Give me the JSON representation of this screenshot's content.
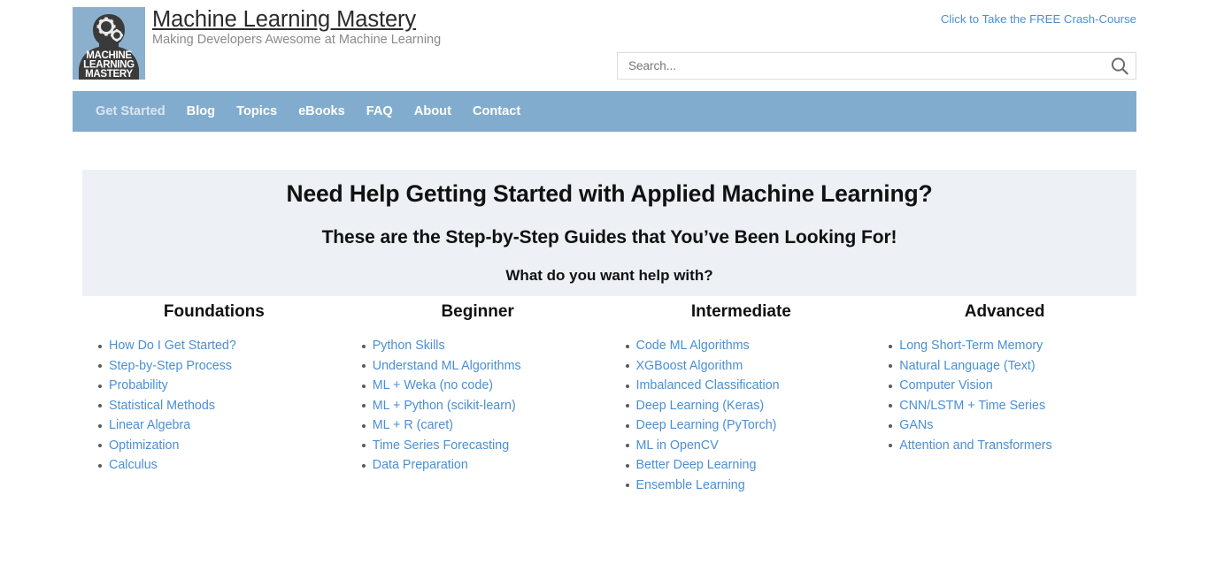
{
  "site": {
    "title": "Machine Learning Mastery",
    "tagline": "Making Developers Awesome at Machine Learning",
    "logo_text_lines": [
      "MACHINE",
      "LEARNING",
      "MASTERY"
    ]
  },
  "header": {
    "crash_course_link": "Click to Take the FREE Crash-Course"
  },
  "search": {
    "placeholder": "Search...",
    "value": "",
    "icon": "search-icon"
  },
  "nav": {
    "items": [
      {
        "label": "Get Started",
        "active": true
      },
      {
        "label": "Blog",
        "active": false
      },
      {
        "label": "Topics",
        "active": false
      },
      {
        "label": "eBooks",
        "active": false
      },
      {
        "label": "FAQ",
        "active": false
      },
      {
        "label": "About",
        "active": false
      },
      {
        "label": "Contact",
        "active": false
      }
    ]
  },
  "hero": {
    "heading": "Need Help Getting Started with Applied Machine Learning?",
    "subheading": "These are the Step-by-Step Guides that You’ve Been Looking For!",
    "prompt": "What do you want help with?",
    "background": "#edf1f5"
  },
  "columns": [
    {
      "title": "Foundations",
      "links": [
        "How Do I Get Started?",
        "Step-by-Step Process",
        "Probability",
        "Statistical Methods",
        "Linear Algebra",
        "Optimization",
        "Calculus"
      ]
    },
    {
      "title": "Beginner",
      "links": [
        "Python Skills",
        "Understand ML Algorithms",
        "ML + Weka (no code)",
        "ML + Python (scikit-learn)",
        "ML + R (caret)",
        "Time Series Forecasting",
        "Data Preparation"
      ]
    },
    {
      "title": "Intermediate",
      "links": [
        "Code ML Algorithms",
        "XGBoost Algorithm",
        "Imbalanced Classification",
        "Deep Learning (Keras)",
        "Deep Learning (PyTorch)",
        "ML in OpenCV",
        "Better Deep Learning",
        "Ensemble Learning"
      ]
    },
    {
      "title": "Advanced",
      "links": [
        "Long Short-Term Memory",
        "Natural Language (Text)",
        "Computer Vision",
        "CNN/LSTM + Time Series",
        "GANs",
        "Attention and Transformers"
      ]
    }
  ],
  "colors": {
    "link": "#4a8fd4",
    "nav_bg": "#82acce",
    "hero_bg": "#edf1f5",
    "logo_bg": "#8ab0cd"
  }
}
